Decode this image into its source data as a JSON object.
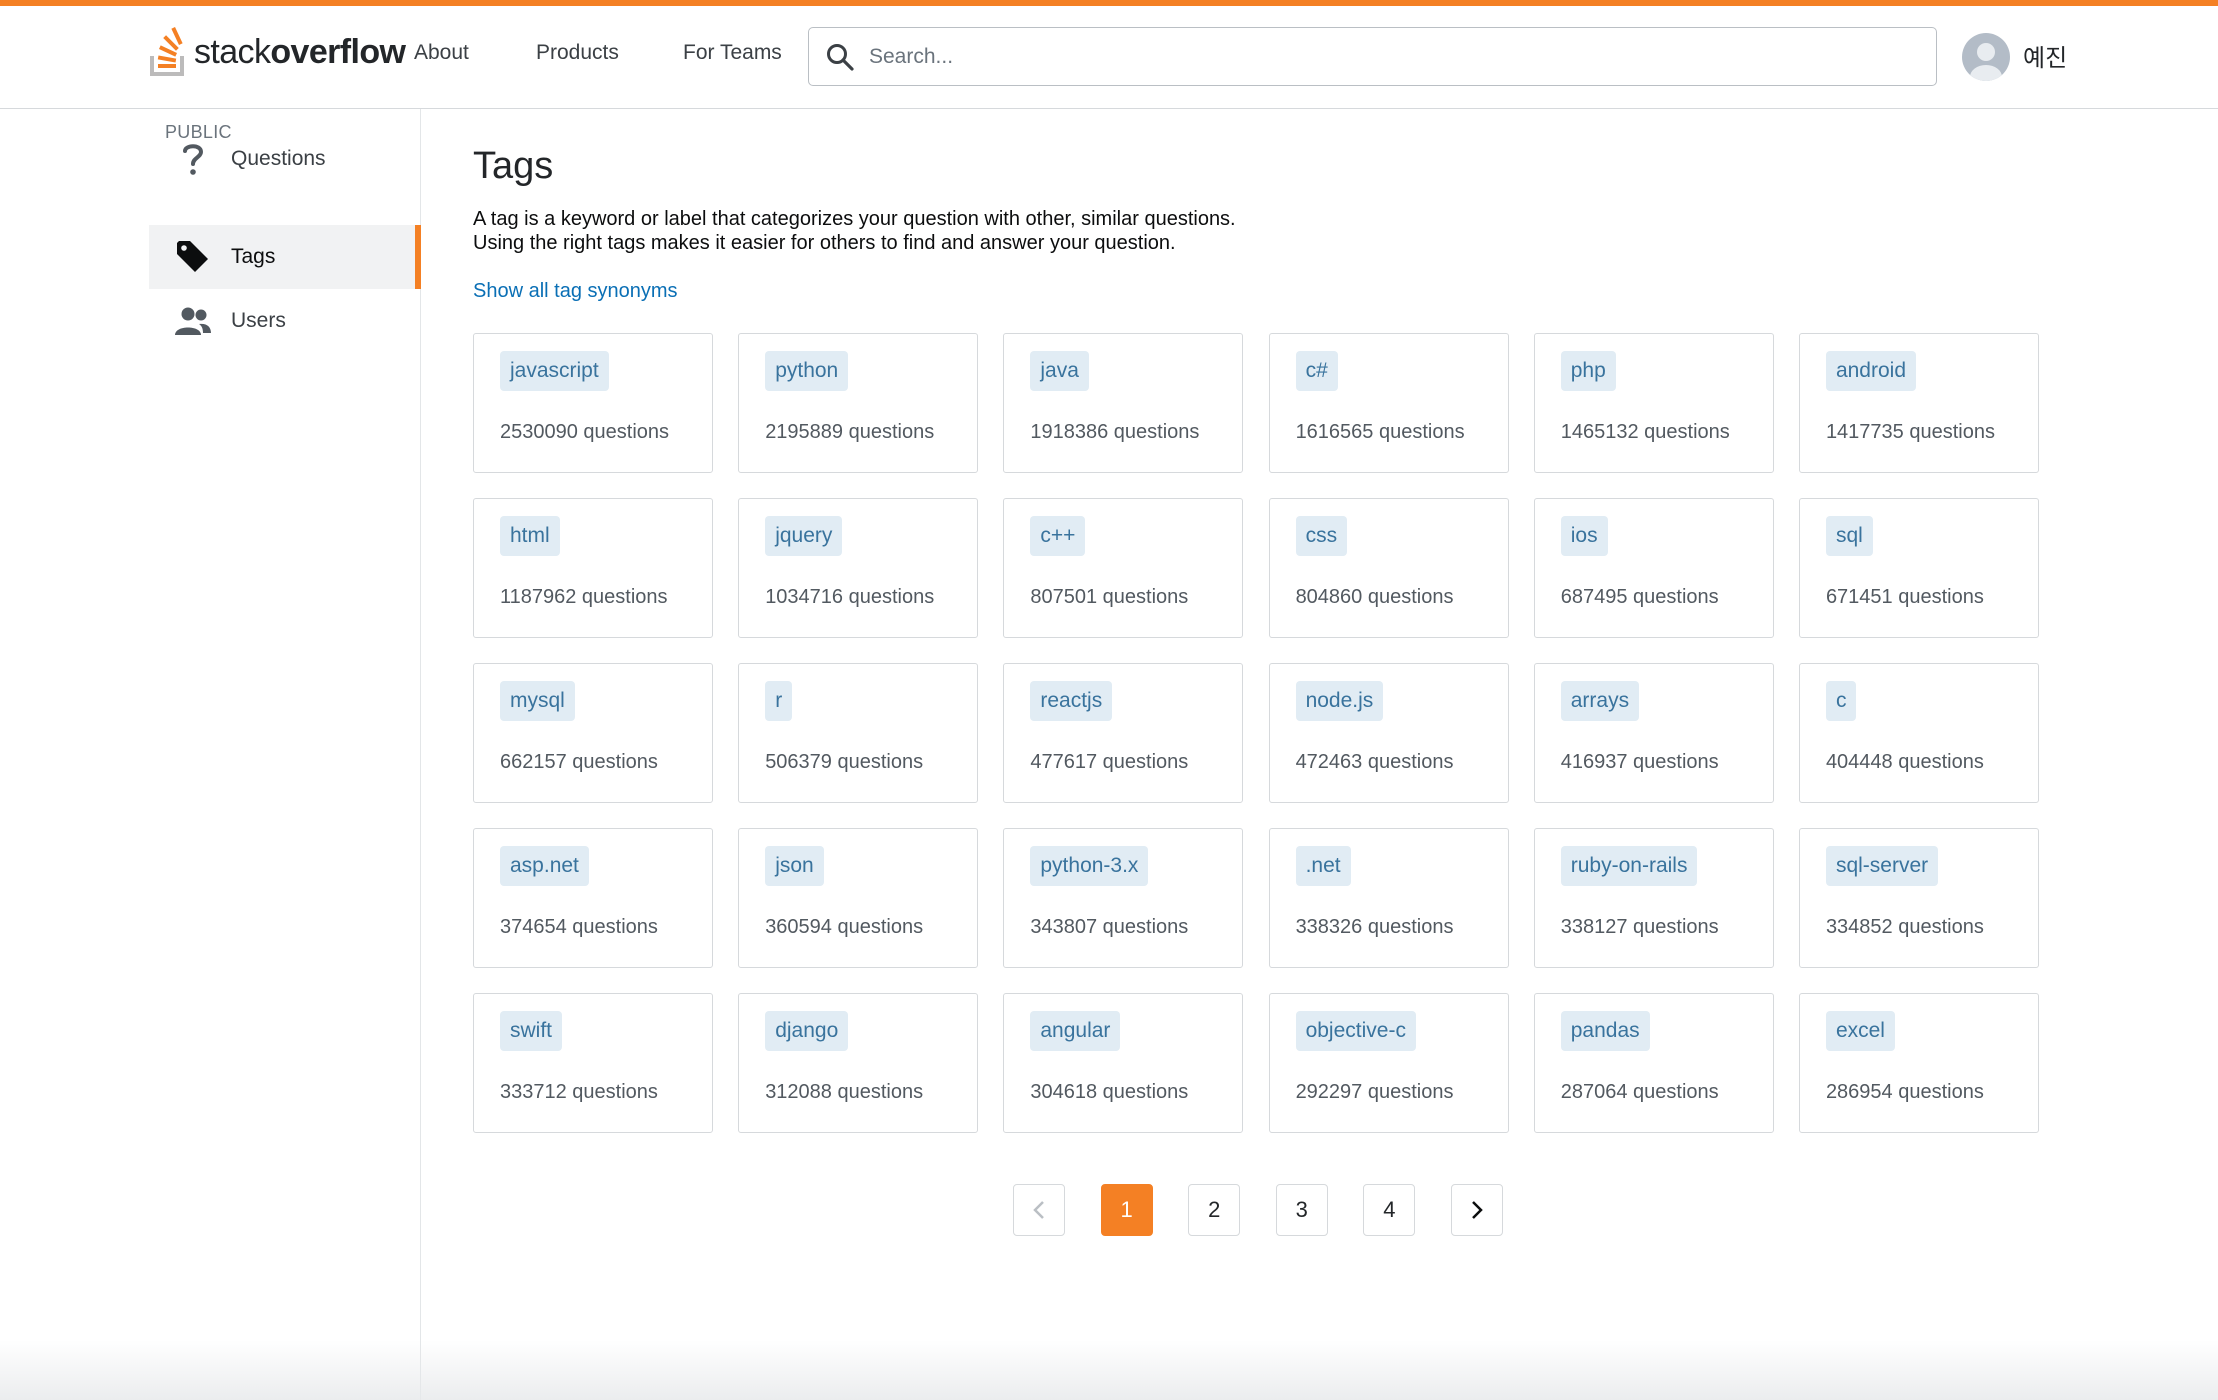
{
  "header": {
    "logo_text_light": "stack",
    "logo_text_bold": "overflow",
    "nav": [
      "About",
      "Products",
      "For Teams"
    ],
    "search_placeholder": "Search...",
    "username": "예진"
  },
  "sidebar": {
    "heading": "PUBLIC",
    "items": [
      {
        "label": "Questions",
        "icon": "question-icon",
        "active": false
      },
      {
        "label": "Tags",
        "icon": "tag-icon",
        "active": true
      },
      {
        "label": "Users",
        "icon": "users-icon",
        "active": false
      }
    ]
  },
  "main": {
    "title": "Tags",
    "description_line1": "A tag is a keyword or label that categorizes your question with other, similar questions.",
    "description_line2": "Using the right tags makes it easier for others to find and answer your question.",
    "synonyms_link": "Show all tag synonyms",
    "tags": [
      {
        "name": "javascript",
        "count": "2530090 questions"
      },
      {
        "name": "python",
        "count": "2195889 questions"
      },
      {
        "name": "java",
        "count": "1918386 questions"
      },
      {
        "name": "c#",
        "count": "1616565 questions"
      },
      {
        "name": "php",
        "count": "1465132 questions"
      },
      {
        "name": "android",
        "count": "1417735 questions"
      },
      {
        "name": "html",
        "count": "1187962 questions"
      },
      {
        "name": "jquery",
        "count": "1034716 questions"
      },
      {
        "name": "c++",
        "count": "807501 questions"
      },
      {
        "name": "css",
        "count": "804860 questions"
      },
      {
        "name": "ios",
        "count": "687495 questions"
      },
      {
        "name": "sql",
        "count": "671451 questions"
      },
      {
        "name": "mysql",
        "count": "662157 questions"
      },
      {
        "name": "r",
        "count": "506379 questions"
      },
      {
        "name": "reactjs",
        "count": "477617 questions"
      },
      {
        "name": "node.js",
        "count": "472463 questions"
      },
      {
        "name": "arrays",
        "count": "416937 questions"
      },
      {
        "name": "c",
        "count": "404448 questions"
      },
      {
        "name": "asp.net",
        "count": "374654 questions"
      },
      {
        "name": "json",
        "count": "360594 questions"
      },
      {
        "name": "python-3.x",
        "count": "343807 questions"
      },
      {
        "name": ".net",
        "count": "338326 questions"
      },
      {
        "name": "ruby-on-rails",
        "count": "338127 questions"
      },
      {
        "name": "sql-server",
        "count": "334852 questions"
      },
      {
        "name": "swift",
        "count": "333712 questions"
      },
      {
        "name": "django",
        "count": "312088 questions"
      },
      {
        "name": "angular",
        "count": "304618 questions"
      },
      {
        "name": "objective-c",
        "count": "292297 questions"
      },
      {
        "name": "pandas",
        "count": "287064 questions"
      },
      {
        "name": "excel",
        "count": "286954 questions"
      }
    ]
  },
  "pagination": {
    "pages": [
      "1",
      "2",
      "3",
      "4"
    ],
    "current": "1",
    "prev_icon": "chevron-left-icon",
    "next_icon": "chevron-right-icon"
  },
  "colors": {
    "accent": "#f48024",
    "tag_bg": "#e1ecf4",
    "tag_text": "#39739d",
    "link": "#0a6fb5"
  }
}
